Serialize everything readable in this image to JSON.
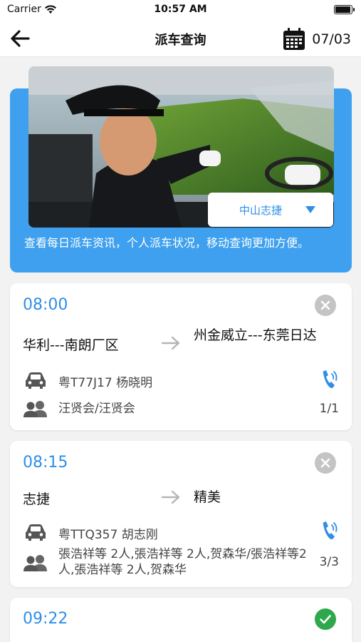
{
  "status_bar": {
    "carrier": "Carrier",
    "time": "10:57 AM",
    "battery_level": 0.95
  },
  "nav": {
    "title": "派车查询",
    "date": "07/03"
  },
  "banner": {
    "region": "中山志捷",
    "description": "查看每日派车资讯，个人派车状况，移动查询更加方便。"
  },
  "trips": [
    {
      "time": "08:00",
      "status": "cancelled",
      "from": "华利---南朗厂区",
      "to": "州金威立---东莞日达",
      "vehicle": "粤T77J17 杨晓明",
      "passengers": "汪贤会/汪贤会",
      "count": "1/1"
    },
    {
      "time": "08:15",
      "status": "cancelled",
      "from": "志捷",
      "to": "精美",
      "vehicle": "粤TTQ357 胡志刚",
      "passengers": "張浩祥等 2人,張浩祥等 2人,贺森华/張浩祥等2人,張浩祥等 2人,贺森华",
      "count": "3/3"
    },
    {
      "time": "09:22",
      "status": "confirmed"
    }
  ],
  "colors": {
    "accent": "#3ea0ee",
    "time_blue": "#2f8ee8",
    "cancel_gray": "#c4c4c4",
    "confirm_green": "#2ea84a"
  }
}
